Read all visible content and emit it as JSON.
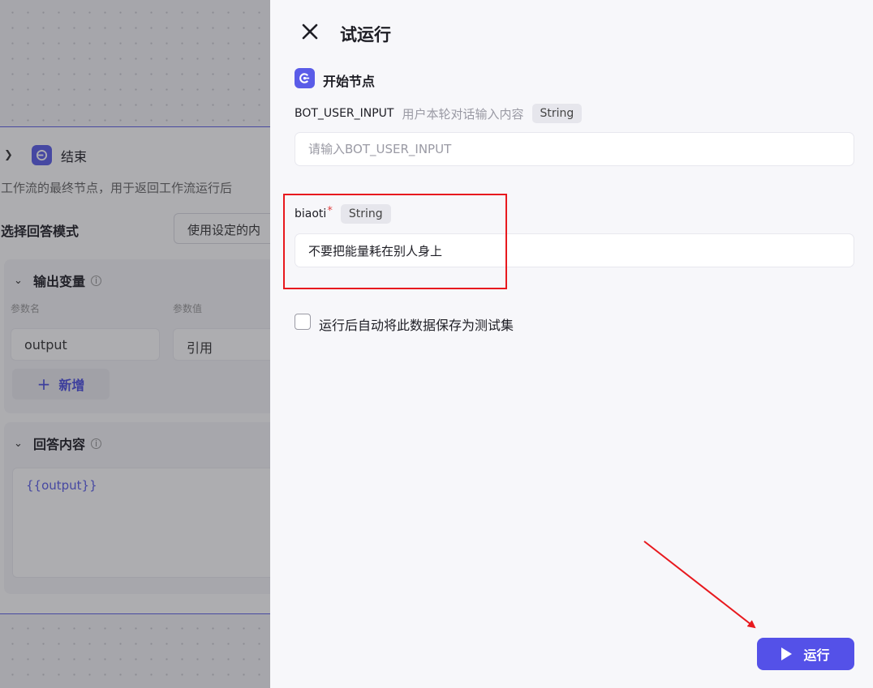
{
  "background_node": {
    "title": "结束",
    "description": "工作流的最终节点，用于返回工作流运行后",
    "answer_mode_label": "选择回答模式",
    "answer_mode_value": "使用设定的内",
    "output_section": {
      "title": "输出变量",
      "col_param_name": "参数名",
      "col_param_value": "参数值",
      "param_name_value": "output",
      "param_value_value": "引用",
      "add_label": "新增"
    },
    "answer_section": {
      "title": "回答内容",
      "content": "{{output}}"
    }
  },
  "drawer": {
    "title": "试运行",
    "section_title": "开始节点",
    "params": [
      {
        "name": "BOT_USER_INPUT",
        "description": "用户本轮对话输入内容",
        "type": "String",
        "value": "",
        "placeholder": "请输入BOT_USER_INPUT"
      },
      {
        "name": "biaoti",
        "required_mark": "*",
        "type": "String",
        "value": "不要把能量耗在别人身上"
      }
    ],
    "save_checkbox_label": "运行后自动将此数据保存为测试集",
    "save_checkbox_checked": false,
    "run_button_label": "运行"
  },
  "colors": {
    "accent": "#5451e8",
    "annotation_red": "#e8191e"
  }
}
